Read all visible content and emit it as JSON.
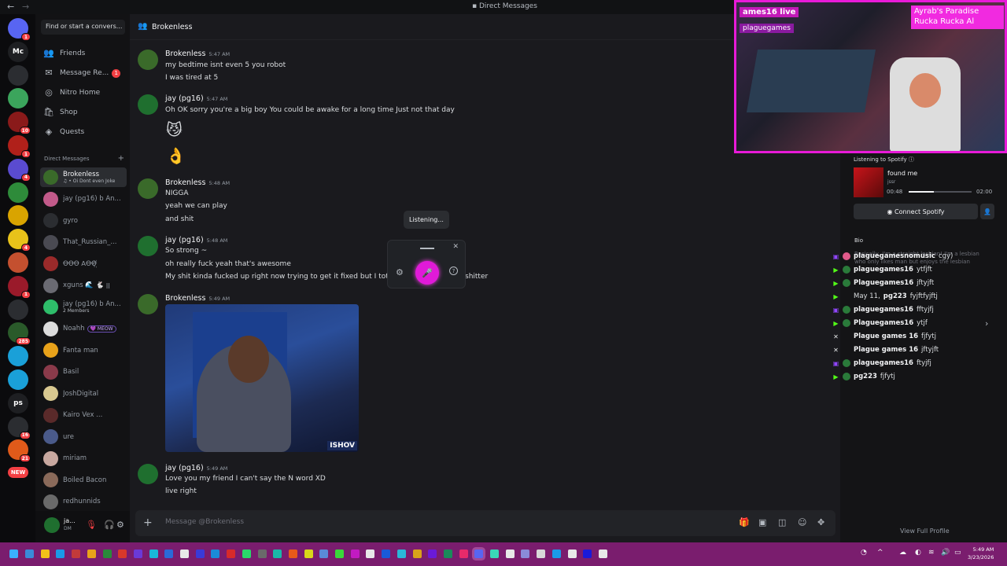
{
  "window": {
    "title": "Direct Messages",
    "back": "←",
    "forward": "→"
  },
  "servers": [
    {
      "name": "discord-home",
      "color": "#5865f2",
      "badge": "1",
      "label": ""
    },
    {
      "name": "mc",
      "color": "#1e1f22",
      "badge": "",
      "label": "Mc"
    },
    {
      "name": "ninja",
      "color": "#2b2d31",
      "badge": "",
      "label": ""
    },
    {
      "name": "green-face",
      "color": "#3ba55c",
      "badge": "",
      "label": ""
    },
    {
      "name": "red-a",
      "color": "#8a1a1a",
      "badge": "10",
      "label": ""
    },
    {
      "name": "red-b",
      "color": "#b0201a",
      "badge": "1",
      "label": ""
    },
    {
      "name": "purple",
      "color": "#5a4bd0",
      "badge": "4",
      "label": ""
    },
    {
      "name": "green-b",
      "color": "#2e8b3a",
      "badge": "",
      "label": ""
    },
    {
      "name": "yellow",
      "color": "#d9a400",
      "badge": "",
      "label": ""
    },
    {
      "name": "pika",
      "color": "#e8c21a",
      "badge": "4",
      "label": ""
    },
    {
      "name": "rainbow",
      "color": "#c4502f",
      "badge": "",
      "label": ""
    },
    {
      "name": "red-c",
      "color": "#9a1a2a",
      "badge": "1",
      "label": ""
    },
    {
      "name": "bw",
      "color": "#2b2d31",
      "badge": "",
      "label": ""
    },
    {
      "name": "badge-285",
      "color": "#2a5a2a",
      "badge": "285",
      "label": ""
    },
    {
      "name": "heart-a",
      "color": "#1aa0d8",
      "badge": "",
      "label": ""
    },
    {
      "name": "heart-b",
      "color": "#1aa0d8",
      "badge": "",
      "label": ""
    },
    {
      "name": "ps",
      "color": "#1e1f22",
      "badge": "",
      "label": "ps"
    },
    {
      "name": "bird",
      "color": "#2b2d31",
      "badge": "16",
      "label": ""
    },
    {
      "name": "orange",
      "color": "#e05a1a",
      "badge": "21",
      "label": ""
    },
    {
      "name": "new",
      "color": "#f23f43",
      "badge": "",
      "label": "NEW"
    }
  ],
  "sidebar": {
    "search_placeholder": "Find or start a convers...",
    "nav": [
      {
        "label": "Friends",
        "icon": "👥",
        "badge": ""
      },
      {
        "label": "Message Re...",
        "icon": "✉",
        "badge": "1"
      },
      {
        "label": "Nitro Home",
        "icon": "◎",
        "badge": ""
      },
      {
        "label": "Shop",
        "icon": "🛍",
        "badge": ""
      },
      {
        "label": "Quests",
        "icon": "◈",
        "badge": ""
      }
    ],
    "dm_header": "Direct Messages",
    "dm_plus": "+",
    "dms": [
      {
        "name": "Brokenless",
        "sub": "♫ • Oi Dont even Joke",
        "color": "#3a6a2a",
        "active": true,
        "tag": ""
      },
      {
        "name": "jay (pg16) b An...",
        "sub": "",
        "color": "#c25a8a",
        "active": false,
        "tag": ""
      },
      {
        "name": "gyro",
        "sub": "",
        "color": "#2b2d31",
        "active": false,
        "tag": ""
      },
      {
        "name": "That_Russian_...",
        "sub": "",
        "color": "#4a4a52",
        "active": false,
        "tag": ""
      },
      {
        "name": "ꝊꝊꝊ ꓮꝊꝊ꙰꙰",
        "sub": "",
        "color": "#9a2a2a",
        "active": false,
        "tag": ""
      },
      {
        "name": "xguns 🌊 🐇 ꞁꞁ",
        "sub": "",
        "color": "#6a6a72",
        "active": false,
        "tag": ""
      },
      {
        "name": "jay (pg16) b An...",
        "sub": "2 Members",
        "color": "#2ebd6a",
        "active": false,
        "tag": ""
      },
      {
        "name": "Noahh",
        "sub": "",
        "color": "#dcdcdc",
        "active": false,
        "tag": "💜 MEOW"
      },
      {
        "name": "Fanta man",
        "sub": "",
        "color": "#e8a21a",
        "active": false,
        "tag": ""
      },
      {
        "name": "Basil",
        "sub": "",
        "color": "#8a3a4a",
        "active": false,
        "tag": ""
      },
      {
        "name": "JoshDigital",
        "sub": "",
        "color": "#d8c890",
        "active": false,
        "tag": ""
      },
      {
        "name": "Kairo Vex ...",
        "sub": "",
        "color": "#5a2a2a",
        "active": false,
        "tag": ""
      },
      {
        "name": "ure",
        "sub": "",
        "color": "#4a5a8a",
        "active": false,
        "tag": ""
      },
      {
        "name": "miriam",
        "sub": "",
        "color": "#c8a8a0",
        "active": false,
        "tag": ""
      },
      {
        "name": "Boiled Bacon",
        "sub": "",
        "color": "#8a6a5a",
        "active": false,
        "tag": ""
      },
      {
        "name": "redhunnids",
        "sub": "",
        "color": "#6a6a6a",
        "active": false,
        "tag": ""
      }
    ]
  },
  "user": {
    "name": "ja...",
    "status": "DM"
  },
  "chat": {
    "channel": "Brokenless",
    "messages": [
      {
        "author": "Brokenless",
        "time": "5:47 AM",
        "color": "#3a6a2a",
        "lines": [
          "my bedtime isnt even 5 you robot",
          "I was tired at 5"
        ]
      },
      {
        "author": "jay (pg16)",
        "time": "5:47 AM",
        "color": "#1f6f2f",
        "lines": [
          "Oh OK sorry you're a big boy You could be awake for a long time Just not that day"
        ],
        "emojis": [
          "😼",
          "👌"
        ]
      },
      {
        "author": "Brokenless",
        "time": "5:48 AM",
        "color": "#3a6a2a",
        "lines": [
          "NIGGA",
          "yeah we can play",
          "and shit"
        ]
      },
      {
        "author": "jay (pg16)",
        "time": "5:48 AM",
        "color": "#1f6f2f",
        "lines": [
          "So strong ~",
          "oh really fuck yeah that's awesome",
          "My shit kinda fucked up right now trying to get it fixed but I totally",
          "shitter"
        ]
      },
      {
        "author": "Brokenless",
        "time": "5:49 AM",
        "color": "#3a6a2a",
        "lines": []
      },
      {
        "author": "jay (pg16)",
        "time": "5:49 AM",
        "color": "#1f6f2f",
        "lines": [
          "Love you my friend I can't say the N word XD",
          "live right"
        ]
      }
    ],
    "image_tag": "ISHOV",
    "composer_placeholder": "Message @Brokenless"
  },
  "voice_popup": {
    "status": "Listening...",
    "close": "✕",
    "help": "?"
  },
  "stream": {
    "title_overlay": "ames16 live",
    "sub_overlay": "plaguegames",
    "corner_overlay": "Ayrab's Paradise Rucka Rucka Al"
  },
  "spotify": {
    "label": "Listening to Spotify ⓘ",
    "song": "found me",
    "artist": "jssr",
    "elapsed": "00:48",
    "duration": "02:00",
    "progress": 0.4,
    "connect": "Connect Spotify"
  },
  "bio": {
    "label": "Bio",
    "text": "Basically, I'm a straight lesbian! I'm a lesbian who only likes man but enjoys the lesbian"
  },
  "stream_chat": [
    {
      "user": "plaguegamesnomusic",
      "msg": "cgy)",
      "platform": "twitch",
      "dot": "#e05a8a"
    },
    {
      "user": "plaguegames16",
      "msg": "ytfjft",
      "platform": "kick",
      "dot": "#2a7a3a"
    },
    {
      "user": "Plaguegames16",
      "msg": "jftyjft",
      "platform": "kick",
      "dot": "#2a7a3a"
    },
    {
      "user": "pg223",
      "msg": "fyjftfyjftj",
      "platform": "kick",
      "dot": "",
      "date": "May 11,"
    },
    {
      "user": "plaguegames16",
      "msg": "fftyjfj",
      "platform": "twitch",
      "dot": "#2a7a3a"
    },
    {
      "user": "Plaguegames16",
      "msg": "ytjf",
      "platform": "kick",
      "dot": "#2a7a3a"
    },
    {
      "user": "Plague games 16",
      "msg": "fjfytj",
      "platform": "x",
      "dot": ""
    },
    {
      "user": "Plague games 16",
      "msg": "jftyjft",
      "platform": "x",
      "dot": ""
    },
    {
      "user": "plaguegames16",
      "msg": "ftyjfj",
      "platform": "twitch",
      "dot": "#2a7a3a"
    },
    {
      "user": "pg223",
      "msg": "fjfytj",
      "platform": "kick",
      "dot": "#2a7a3a"
    }
  ],
  "view_full_profile": "View Full Profile",
  "taskbar": {
    "time": "5:49 AM",
    "date": "3/23/2026",
    "apps": [
      "#3a8ad8",
      "#f2c21a",
      "#1a9ae8",
      "#c23a3a",
      "#e8a21a",
      "#2a8a3a",
      "#d8382a",
      "#6a3ad8",
      "#1ab8d8",
      "#2a6ad8",
      "#e8e8e8",
      "#3a3ad8",
      "#1a8ad8",
      "#d82a2a",
      "#2ad86a",
      "#6a6a6a",
      "#1ab8a8",
      "#e85a1a",
      "#d8d81a",
      "#5a8ad8",
      "#3ad83a",
      "#c21ac2",
      "#e8e8e8",
      "#1a5ad8",
      "#2ab8d8",
      "#d8a21a",
      "#6a1ad8",
      "#1a8a5a",
      "#e82a6a",
      "#5865f2",
      "#3ad8b8",
      "#e8e8e8",
      "#8a8ad8",
      "#d8d8d8",
      "#1a9ae8",
      "#e8e8e8",
      "#1a1ad8",
      "#e8e8e8"
    ]
  }
}
